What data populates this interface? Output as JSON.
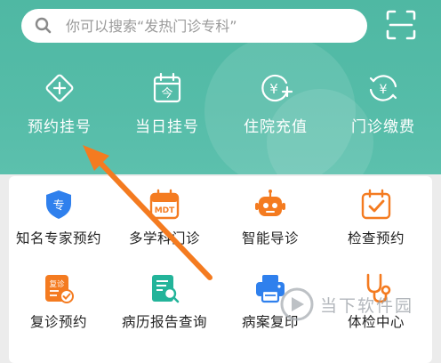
{
  "search": {
    "placeholder": "你可以搜索“发热门诊专科”",
    "icon": "search-icon"
  },
  "header": {
    "scan_icon": "scan-icon",
    "quick_actions": [
      {
        "label": "预约挂号",
        "icon": "diamond-plus-icon"
      },
      {
        "label": "当日挂号",
        "icon": "calendar-today-icon"
      },
      {
        "label": "住院充值",
        "icon": "yen-plus-icon"
      },
      {
        "label": "门诊缴费",
        "icon": "yen-refresh-icon"
      }
    ]
  },
  "services": [
    {
      "label": "知名专家预约",
      "icon": "shield-expert-icon",
      "icon_text": "专"
    },
    {
      "label": "多学科门诊",
      "icon": "mdt-calendar-icon",
      "icon_text": "MDT"
    },
    {
      "label": "智能导诊",
      "icon": "robot-icon"
    },
    {
      "label": "检查预约",
      "icon": "calendar-check-icon"
    },
    {
      "label": "复诊预约",
      "icon": "revisit-doc-icon",
      "icon_text": "复诊"
    },
    {
      "label": "病历报告查询",
      "icon": "report-search-icon"
    },
    {
      "label": "病案复印",
      "icon": "printer-icon"
    },
    {
      "label": "体检中心",
      "icon": "stethoscope-icon"
    }
  ],
  "watermark": {
    "text": "当下软件园"
  },
  "colors": {
    "header_bg": "#55bca8",
    "accent_orange": "#f47b20",
    "icon_blue": "#2f80ed",
    "icon_teal": "#23b49a"
  }
}
